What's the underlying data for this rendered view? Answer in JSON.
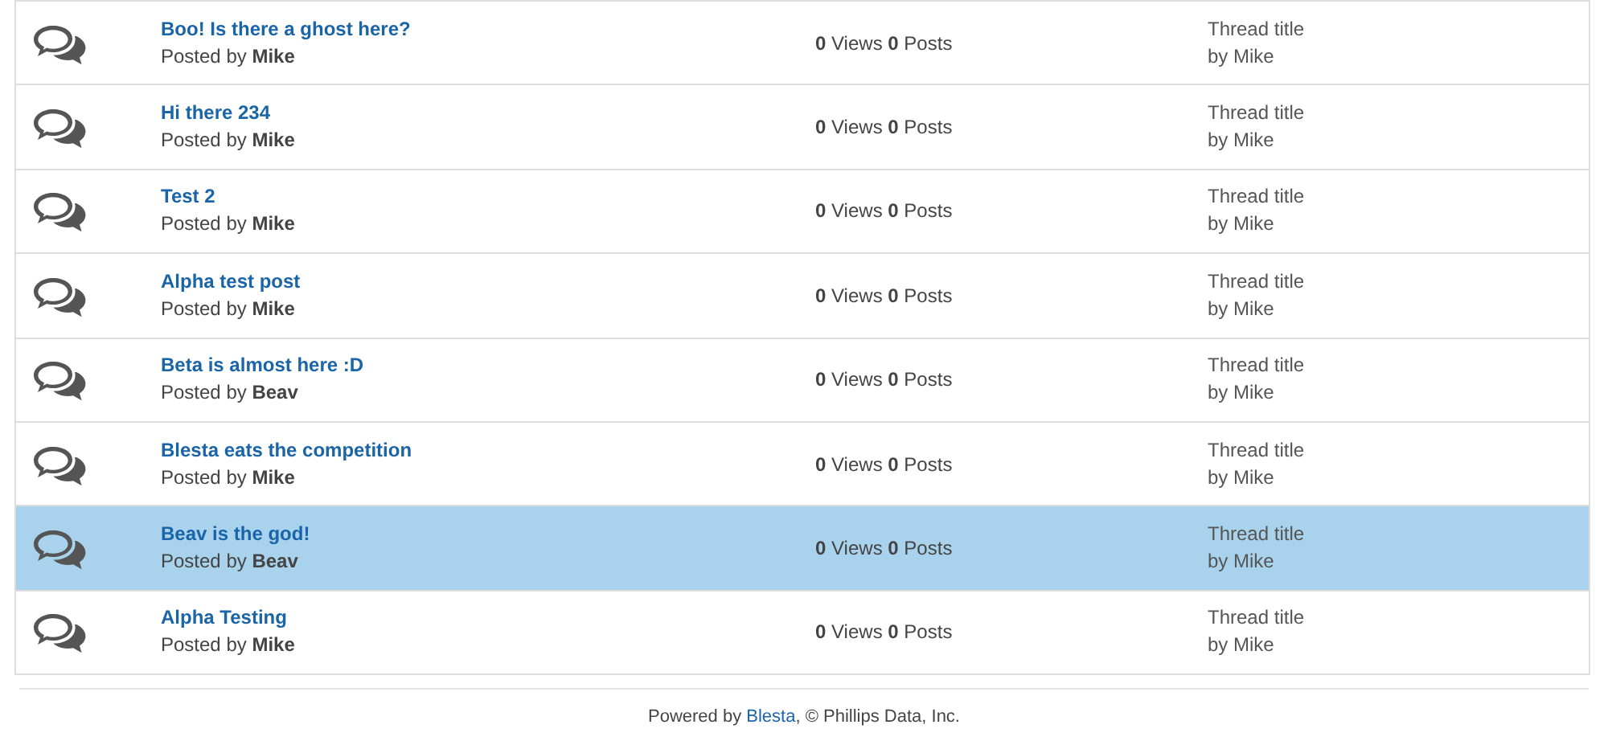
{
  "threads": [
    {
      "title": "Boo! Is there a ghost here?",
      "byline": "Posted by **Mike**",
      "stats": "**0** Views **0** Posts",
      "last_title": "Thread title",
      "last_by": "by Mike",
      "selected": false
    },
    {
      "title": "Hi there 234",
      "byline": "Posted by **Mike**",
      "stats": "**0** Views **0** Posts",
      "last_title": "Thread title",
      "last_by": "by Mike",
      "selected": false
    },
    {
      "title": "Test 2",
      "byline": "Posted by **Mike**",
      "stats": "**0** Views **0** Posts",
      "last_title": "Thread title",
      "last_by": "by Mike",
      "selected": false
    },
    {
      "title": "Alpha test post",
      "byline": "Posted by **Mike**",
      "stats": "**0** Views **0** Posts",
      "last_title": "Thread title",
      "last_by": "by Mike",
      "selected": false
    },
    {
      "title": "Beta is almost here :D",
      "byline": "Posted by **Beav**",
      "stats": "**0** Views **0** Posts",
      "last_title": "Thread title",
      "last_by": "by Mike",
      "selected": false
    },
    {
      "title": "Blesta eats the competition",
      "byline": "Posted by **Mike**",
      "stats": "**0** Views **0** Posts",
      "last_title": "Thread title",
      "last_by": "by Mike",
      "selected": false
    },
    {
      "title": "Beav is the god!",
      "byline": "Posted by **Beav**",
      "stats": "**0** Views **0** Posts",
      "last_title": "Thread title",
      "last_by": "by Mike",
      "selected": true
    },
    {
      "title": "Alpha Testing",
      "byline": "Posted by **Mike**",
      "stats": "**0** Views **0** Posts",
      "last_title": "Thread title",
      "last_by": "by Mike",
      "selected": false
    }
  ],
  "footer": {
    "prefix": "Powered by ",
    "link": "Blesta",
    "suffix": ", © Phillips Data, Inc."
  }
}
